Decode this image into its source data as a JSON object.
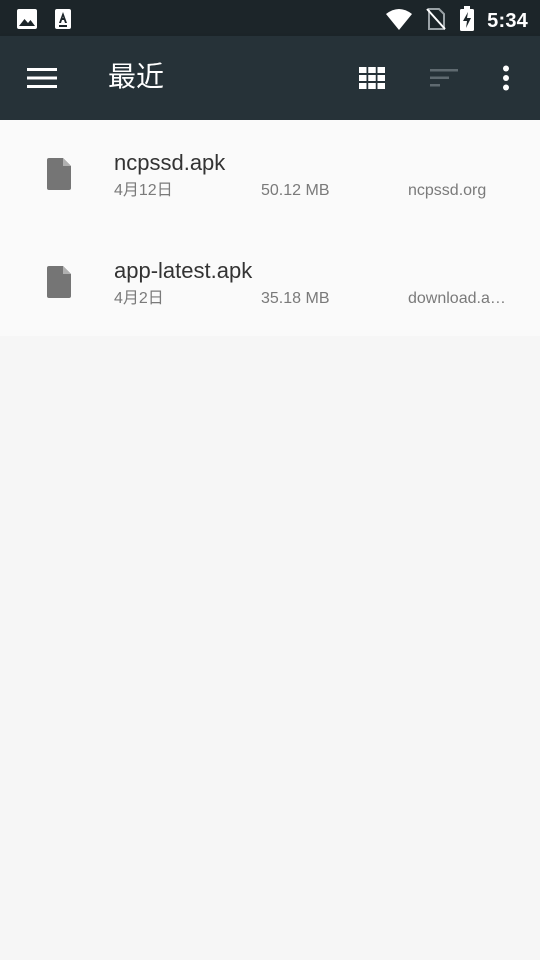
{
  "status_bar": {
    "time": "5:34",
    "left_icons": [
      "image-icon",
      "font-icon"
    ],
    "right_icons": [
      "wifi-icon",
      "no-sim-icon",
      "battery-charging-icon"
    ]
  },
  "app_bar": {
    "title": "最近",
    "background": "#263238",
    "actions": [
      "menu-icon",
      "grid-view-icon",
      "sort-icon",
      "more-vert-icon"
    ]
  },
  "files": [
    {
      "name": "ncpssd.apk",
      "date": "4月12日",
      "size": "50.12 MB",
      "source": "ncpssd.org",
      "icon": "file-icon"
    },
    {
      "name": "app-latest.apk",
      "date": "4月2日",
      "size": "35.18 MB",
      "source": "download.a…",
      "icon": "file-icon"
    }
  ],
  "colors": {
    "status_bar": "#1c2529",
    "toolbar": "#263238",
    "list_background": "#fafafa",
    "page_background": "#f6f6f6"
  }
}
